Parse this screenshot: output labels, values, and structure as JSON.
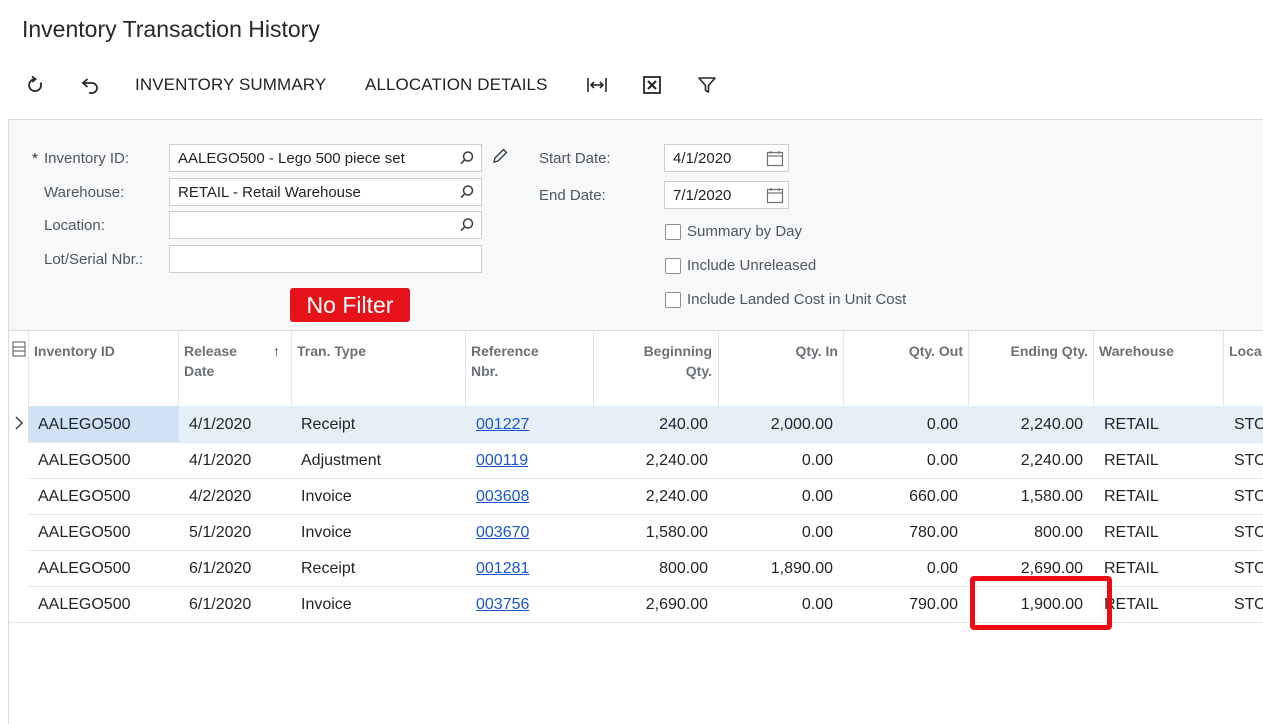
{
  "page": {
    "title": "Inventory Transaction History"
  },
  "toolbar": {
    "refresh_icon": "refresh-icon",
    "undo_icon": "undo-icon",
    "inventory_summary": "INVENTORY SUMMARY",
    "allocation_details": "ALLOCATION DETAILS",
    "fit_icon": "fit-to-screen-icon",
    "excel_icon": "excel-export-icon",
    "filter_icon": "filter-icon"
  },
  "form": {
    "inventory_id_label": "Inventory ID:",
    "inventory_id_value": "AALEGO500 - Lego 500 piece set",
    "warehouse_label": "Warehouse:",
    "warehouse_value": "RETAIL - Retail Warehouse",
    "location_label": "Location:",
    "location_value": "",
    "lot_label": "Lot/Serial Nbr.:",
    "lot_value": "",
    "start_date_label": "Start Date:",
    "start_date_value": "4/1/2020",
    "end_date_label": "End Date:",
    "end_date_value": "7/1/2020",
    "summary_by_day": "Summary by Day",
    "include_unreleased": "Include Unreleased",
    "include_landed_cost": "Include Landed Cost in Unit Cost",
    "required_mark": "*"
  },
  "annotation": {
    "no_filter": "No Filter"
  },
  "grid": {
    "headers": {
      "inventory_id": "Inventory ID",
      "release_date_1": "Release",
      "release_date_2": "Date",
      "sort_arrow": "↑",
      "tran_type": "Tran. Type",
      "reference_1": "Reference",
      "reference_2": "Nbr.",
      "beginning_1": "Beginning",
      "beginning_2": "Qty.",
      "qty_in": "Qty. In",
      "qty_out": "Qty. Out",
      "ending_qty": "Ending Qty.",
      "warehouse": "Warehouse",
      "location": "Loca"
    },
    "rows": [
      {
        "inventory_id": "AALEGO500",
        "release_date": "4/1/2020",
        "tran_type": "Receipt",
        "reference": "001227",
        "beginning": "240.00",
        "qty_in": "2,000.00",
        "qty_out": "0.00",
        "ending": "2,240.00",
        "warehouse": "RETAIL",
        "location": "STO"
      },
      {
        "inventory_id": "AALEGO500",
        "release_date": "4/1/2020",
        "tran_type": "Adjustment",
        "reference": "000119",
        "beginning": "2,240.00",
        "qty_in": "0.00",
        "qty_out": "0.00",
        "ending": "2,240.00",
        "warehouse": "RETAIL",
        "location": "STO"
      },
      {
        "inventory_id": "AALEGO500",
        "release_date": "4/2/2020",
        "tran_type": "Invoice",
        "reference": "003608",
        "beginning": "2,240.00",
        "qty_in": "0.00",
        "qty_out": "660.00",
        "ending": "1,580.00",
        "warehouse": "RETAIL",
        "location": "STO"
      },
      {
        "inventory_id": "AALEGO500",
        "release_date": "5/1/2020",
        "tran_type": "Invoice",
        "reference": "003670",
        "beginning": "1,580.00",
        "qty_in": "0.00",
        "qty_out": "780.00",
        "ending": "800.00",
        "warehouse": "RETAIL",
        "location": "STO"
      },
      {
        "inventory_id": "AALEGO500",
        "release_date": "6/1/2020",
        "tran_type": "Receipt",
        "reference": "001281",
        "beginning": "800.00",
        "qty_in": "1,890.00",
        "qty_out": "0.00",
        "ending": "2,690.00",
        "warehouse": "RETAIL",
        "location": "STO"
      },
      {
        "inventory_id": "AALEGO500",
        "release_date": "6/1/2020",
        "tran_type": "Invoice",
        "reference": "003756",
        "beginning": "2,690.00",
        "qty_in": "0.00",
        "qty_out": "790.00",
        "ending": "1,900.00",
        "warehouse": "RETAIL",
        "location": "STO"
      }
    ]
  }
}
